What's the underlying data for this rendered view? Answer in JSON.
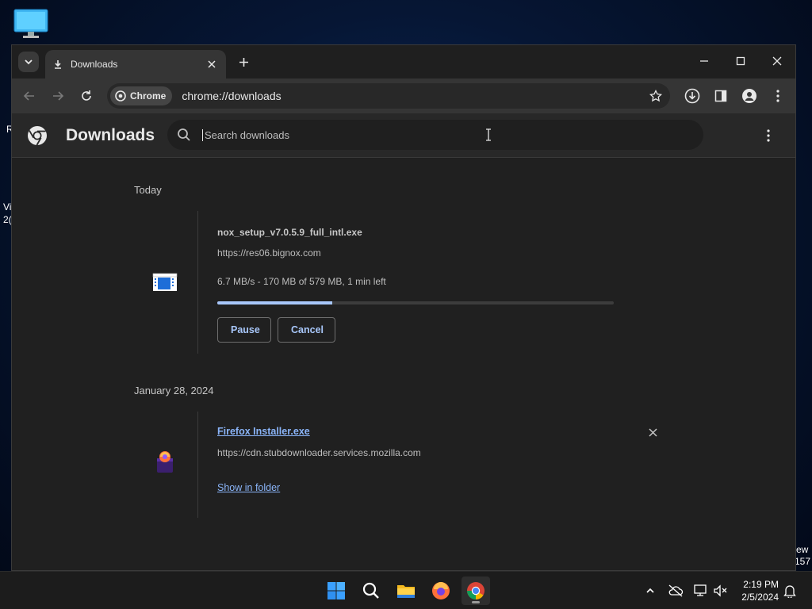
{
  "desktop": {
    "fragments": [
      "R",
      "Vi",
      "2(",
      "ew",
      "157"
    ]
  },
  "browser": {
    "tab": {
      "title": "Downloads"
    },
    "omnibox": {
      "chip_label": "Chrome",
      "url": "chrome://downloads"
    }
  },
  "downloads_page": {
    "title": "Downloads",
    "search": {
      "placeholder": "Search downloads"
    },
    "groups": [
      {
        "date": "Today",
        "item": {
          "file_name": "nox_setup_v7.0.5.9_full_intl.exe",
          "source_url": "https://res06.bignox.com",
          "status": "6.7 MB/s - 170 MB of 579 MB, 1 min left",
          "progress_percent": 29,
          "pause_label": "Pause",
          "cancel_label": "Cancel"
        }
      },
      {
        "date": "January 28, 2024",
        "item": {
          "file_name": "Firefox Installer.exe",
          "source_url": "https://cdn.stubdownloader.services.mozilla.com",
          "show_in_folder_label": "Show in folder"
        }
      }
    ]
  },
  "taskbar": {
    "time": "2:19 PM",
    "date": "2/5/2024"
  },
  "colors": {
    "accent": "#a8c7fa",
    "link": "#8ab4f8",
    "page_bg": "#202020",
    "header_bg": "#282828"
  }
}
